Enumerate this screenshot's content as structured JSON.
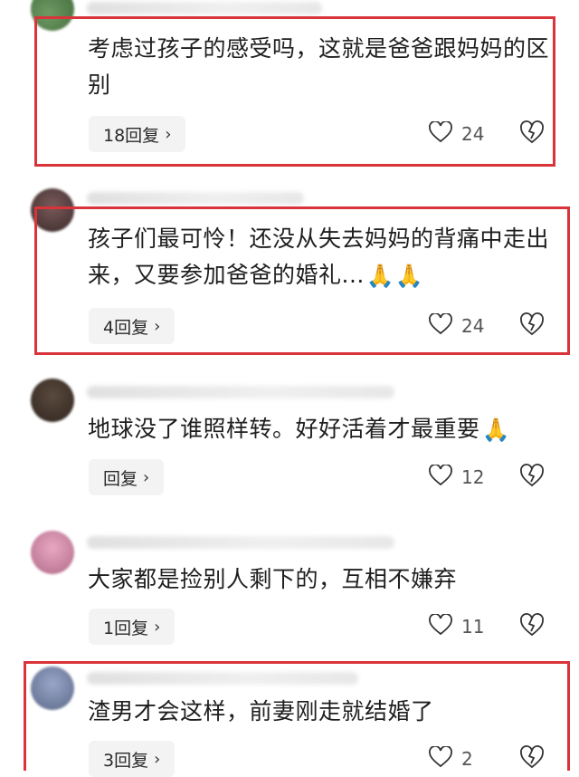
{
  "comments": [
    {
      "text": "考虑过孩子的感受吗，这就是爸爸跟妈妈的区别",
      "reply_label": "18回复",
      "likes": "24",
      "highlighted": true
    },
    {
      "text": "孩子们最可怜！还没从失去妈妈的背痛中走出来，又要参加爸爸的婚礼...",
      "emoji": "🙏🙏",
      "reply_label": "4回复",
      "likes": "24",
      "highlighted": true
    },
    {
      "text": "地球没了谁照样转。好好活着才最重要",
      "emoji": "🙏",
      "reply_label": "回复",
      "likes": "12",
      "highlighted": false
    },
    {
      "text": "大家都是捡别人剩下的，互相不嫌弃",
      "reply_label": "1回复",
      "likes": "11",
      "highlighted": false
    },
    {
      "text": "渣男才会这样，前妻刚走就结婚了",
      "reply_label": "3回复",
      "likes": "2",
      "highlighted": true
    }
  ],
  "chevron": "›",
  "colors": {
    "highlight": "#d8343a",
    "pill_bg": "#f3f3f3"
  }
}
